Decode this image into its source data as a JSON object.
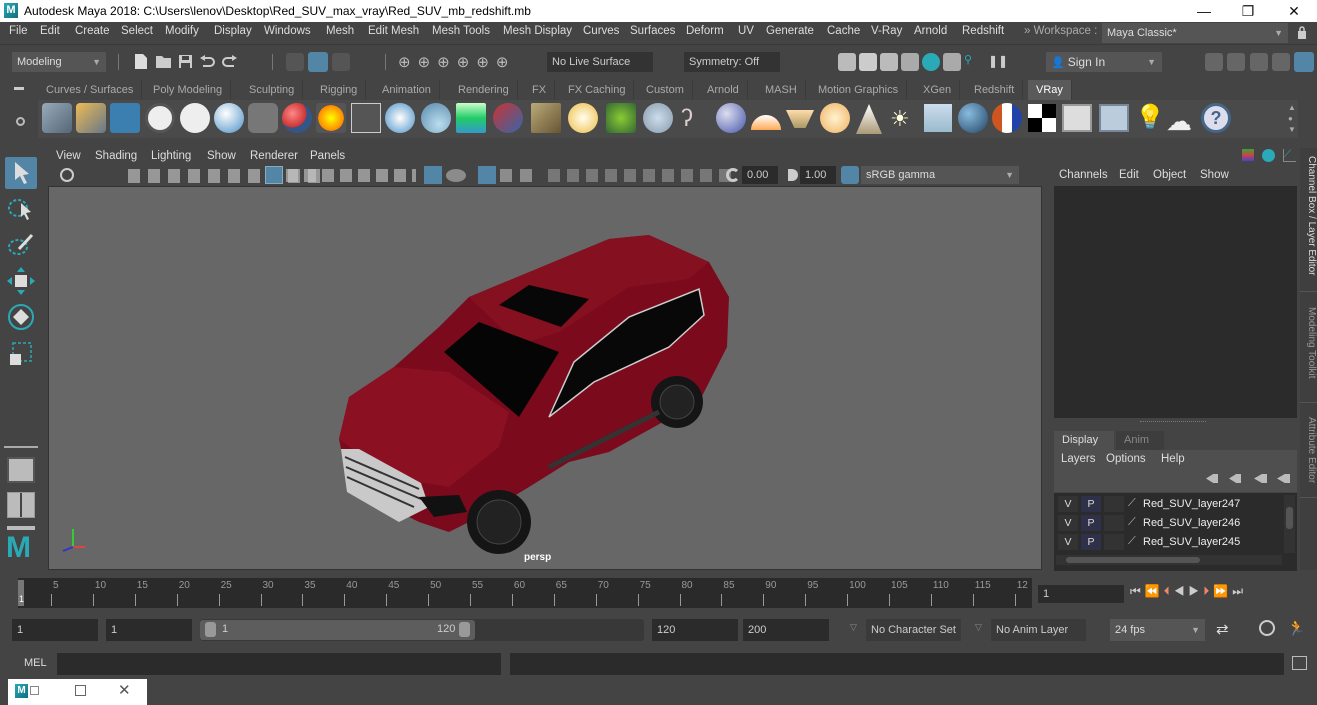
{
  "window": {
    "title": "Autodesk Maya 2018: C:\\Users\\lenov\\Desktop\\Red_SUV_max_vray\\Red_SUV_mb_redshift.mb",
    "app_icon": "maya-logo-icon",
    "controls": {
      "minimize": "—",
      "restore": "❐",
      "close": "✕"
    }
  },
  "menubar": {
    "items": [
      "File",
      "Edit",
      "Create",
      "Select",
      "Modify",
      "Display",
      "Windows",
      "Mesh",
      "Edit Mesh",
      "Mesh Tools",
      "Mesh Display",
      "Curves",
      "Surfaces",
      "Deform",
      "UV",
      "Generate",
      "Cache",
      "V-Ray",
      "Arnold",
      "Redshift"
    ],
    "workspace_label": "Workspace :",
    "workspace_value": "Maya Classic*"
  },
  "statusline": {
    "menuset": "Modeling",
    "live_surface": "No Live Surface",
    "symmetry": "Symmetry: Off",
    "sign_in": "Sign In"
  },
  "shelf": {
    "tabs": [
      "Curves / Surfaces",
      "Poly Modeling",
      "Sculpting",
      "Rigging",
      "Animation",
      "Rendering",
      "FX",
      "FX Caching",
      "Custom",
      "Arnold",
      "MASH",
      "Motion Graphics",
      "XGen",
      "Redshift",
      "VRay"
    ],
    "active_tab": "VRay",
    "icons": [
      "vray-export-icon",
      "vray-export-folder-icon",
      "vray-scene-icon",
      "vray-logo-icon",
      "vray-framebuffer-icon",
      "vray-light-dome-icon",
      "vray-camera-icon",
      "vray-material-icon",
      "vray-fire-icon",
      "vray-proxy-icon",
      "vray-sphere-icon",
      "vray-mesh-light-icon",
      "vray-plane-light-icon",
      "vray-mtl-wrapper-icon",
      "vray-texture-icon",
      "vray-sphere-fade-icon",
      "vray-fur-icon",
      "vray-gear-icon",
      "vray-curve-icon",
      "vray-globe-icon",
      "vray-dome-light-icon",
      "vray-spot-light-icon",
      "vray-omni-light-icon",
      "vray-ies-light-icon",
      "vray-sun-icon",
      "vray-sky-icon",
      "vray-ball-icon",
      "vray-split-sphere-icon",
      "vray-checker-icon",
      "vray-vfb-icon",
      "vray-settings-icon",
      "vray-bulb-icon",
      "vray-cloud-icon",
      "help-icon"
    ]
  },
  "toolbox": {
    "tools": [
      "select-tool-icon",
      "lasso-select-icon",
      "paint-select-icon",
      "move-tool-icon",
      "rotate-tool-icon",
      "scale-tool-icon"
    ],
    "layout_buttons": [
      "single-view-layout-icon",
      "four-view-layout-icon",
      "outliner-layout-icon"
    ]
  },
  "viewport": {
    "menus": [
      "View",
      "Shading",
      "Lighting",
      "Show",
      "Renderer",
      "Panels"
    ],
    "exposure": "0.00",
    "gamma": "1.00",
    "color_space": "sRGB gamma",
    "camera_label": "persp",
    "body_color": "#7a0a1c",
    "bg_color": "#676767"
  },
  "channelbox": {
    "menus": [
      "Channels",
      "Edit",
      "Object",
      "Show"
    ]
  },
  "layer_editor": {
    "tabs": [
      "Display",
      "Anim"
    ],
    "active_tab": "Display",
    "menus": [
      "Layers",
      "Options",
      "Help"
    ],
    "layers": [
      {
        "v": "V",
        "p": "P",
        "name": "Red_SUV_layer247"
      },
      {
        "v": "V",
        "p": "P",
        "name": "Red_SUV_layer246"
      },
      {
        "v": "V",
        "p": "P",
        "name": "Red_SUV_layer245"
      }
    ]
  },
  "side_tabs": [
    "Channel Box / Layer Editor",
    "Modeling Toolkit",
    "Attribute Editor"
  ],
  "timeline": {
    "ticks": [
      "5",
      "10",
      "15",
      "20",
      "25",
      "30",
      "35",
      "40",
      "45",
      "50",
      "55",
      "60",
      "65",
      "70",
      "75",
      "80",
      "85",
      "90",
      "95",
      "100",
      "105",
      "110",
      "115",
      "12"
    ],
    "current_frame_marker": "1",
    "current_frame": "1"
  },
  "range": {
    "start_frame": "1",
    "playback_start": "1",
    "slider_min": "1",
    "slider_max": "120",
    "playback_end": "120",
    "end_frame": "200",
    "character_set": "No Character Set",
    "anim_layer": "No Anim Layer",
    "fps": "24 fps"
  },
  "cmdline": {
    "label": "MEL",
    "value": ""
  },
  "accent_color": "#5285a6"
}
